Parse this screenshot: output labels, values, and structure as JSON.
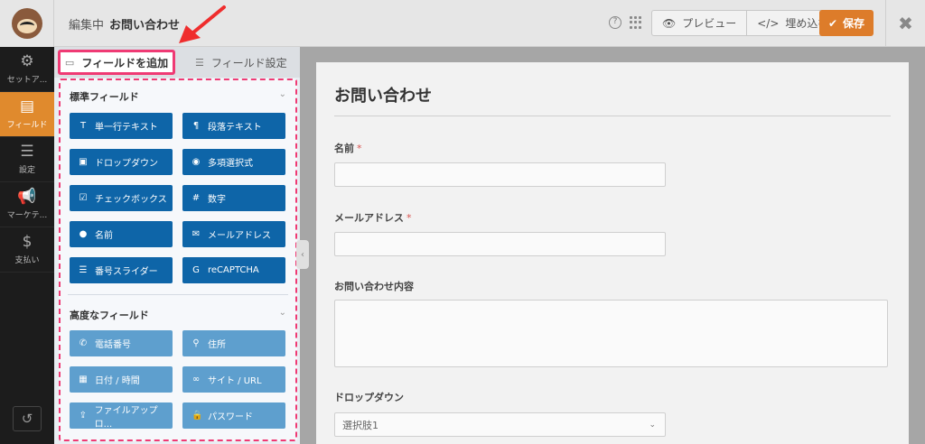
{
  "topbar": {
    "editing_label": "編集中",
    "form_name": "お問い合わせ",
    "preview_label": "プレビュー",
    "embed_label": "埋め込む",
    "save_label": "保存",
    "close_glyph": "✖"
  },
  "sidebar": {
    "items": [
      {
        "label": "セットア...",
        "icon": "gear-icon",
        "active": false
      },
      {
        "label": "フィールド",
        "icon": "fields-icon",
        "active": true
      },
      {
        "label": "設定",
        "icon": "sliders-icon",
        "active": false
      },
      {
        "label": "マーケテ...",
        "icon": "megaphone-icon",
        "active": false
      },
      {
        "label": "支払い",
        "icon": "dollar-icon",
        "active": false
      }
    ]
  },
  "panel": {
    "tab_add": "フィールドを追加",
    "tab_settings": "フィールド設定",
    "standard_heading": "標準フィールド",
    "advanced_heading": "高度なフィールド",
    "standard_fields": [
      {
        "label": "単一行テキスト",
        "icon": "text-icon"
      },
      {
        "label": "段落テキスト",
        "icon": "paragraph-icon"
      },
      {
        "label": "ドロップダウン",
        "icon": "dropdown-icon"
      },
      {
        "label": "多項選択式",
        "icon": "radio-icon"
      },
      {
        "label": "チェックボックス",
        "icon": "checkbox-icon"
      },
      {
        "label": "数字",
        "icon": "hash-icon"
      },
      {
        "label": "名前",
        "icon": "user-icon"
      },
      {
        "label": "メールアドレス",
        "icon": "envelope-icon"
      },
      {
        "label": "番号スライダー",
        "icon": "slider-icon"
      },
      {
        "label": "reCAPTCHA",
        "icon": "google-icon"
      }
    ],
    "advanced_fields": [
      {
        "label": "電話番号",
        "icon": "phone-icon"
      },
      {
        "label": "住所",
        "icon": "map-pin-icon"
      },
      {
        "label": "日付 / 時間",
        "icon": "calendar-icon"
      },
      {
        "label": "サイト / URL",
        "icon": "link-icon"
      },
      {
        "label": "ファイルアップロ...",
        "icon": "upload-icon"
      },
      {
        "label": "パスワード",
        "icon": "lock-icon"
      }
    ]
  },
  "preview": {
    "title": "お問い合わせ",
    "fields": [
      {
        "label": "名前",
        "required": "*"
      },
      {
        "label": "メールアドレス",
        "required": "*"
      },
      {
        "label": "お問い合わせ内容",
        "required": ""
      },
      {
        "label": "ドロップダウン",
        "required": ""
      }
    ],
    "dropdown_value": "選択肢1"
  },
  "colors": {
    "accent": "#e08a2d",
    "highlight": "#ef3a74",
    "standard_button": "#0e65a8",
    "advanced_button": "#5e9fce"
  }
}
